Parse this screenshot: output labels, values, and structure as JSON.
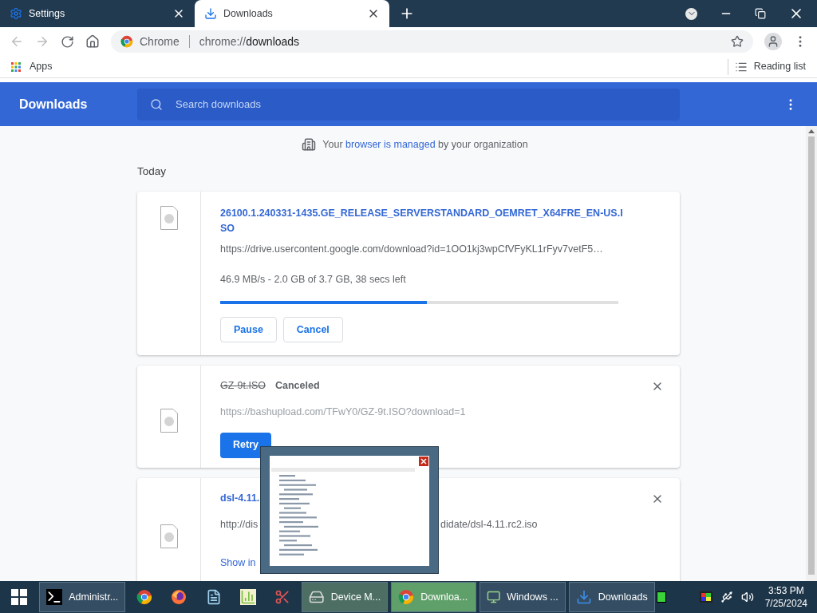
{
  "browser_tabs": [
    {
      "title": "Settings",
      "kind": "gear",
      "selected": false
    },
    {
      "title": "Downloads",
      "kind": "download",
      "selected": true
    }
  ],
  "address_bar": {
    "site": "Chrome",
    "url_prefix": "chrome://",
    "url_path": "downloads"
  },
  "bookmarks_bar": {
    "apps": "Apps",
    "reading_list": "Reading list"
  },
  "header": {
    "title": "Downloads",
    "search_placeholder": "Search downloads"
  },
  "managed_notice": {
    "before": "Your",
    "link": "browser is managed",
    "after": "by your organization"
  },
  "section_title": "Today",
  "downloads": [
    {
      "kind": "in_progress",
      "name": "26100.1.240331-1435.GE_RELEASE_SERVERSTANDARD_OEMRET_X64FRE_EN-US.ISO",
      "url": "https://drive.usercontent.google.com/download?id=1OO1kj3wpCfVFyKL1rFyv7vetF5…",
      "status": "46.9 MB/s - 2.0 GB of 3.7 GB, 38 secs left",
      "level": 0.52,
      "buttons": [
        "Pause",
        "Cancel"
      ]
    },
    {
      "kind": "canceled",
      "name": "GZ-9t.ISO",
      "status": "Canceled",
      "url": "https://bashupload.com/TFwY0/GZ-9t.ISO?download=1",
      "buttons": [
        "Retry"
      ]
    },
    {
      "kind": "complete",
      "name": "dsl-4.11.",
      "url_parts": [
        "http://dis",
        "didate/dsl-4.11.rc2.iso"
      ],
      "link": "Show in"
    }
  ],
  "taskbar": {
    "items": [
      {
        "kind": "terminal",
        "label": "Administr...",
        "selected": false,
        "hovered": false
      },
      {
        "kind": "chrome",
        "selected": false,
        "hovered": false
      },
      {
        "kind": "firefox",
        "selected": false,
        "hovered": false
      },
      {
        "kind": "notepad",
        "selected": false,
        "hovered": false
      },
      {
        "kind": "chart",
        "selected": false,
        "hovered": false
      },
      {
        "kind": "scissors",
        "selected": false,
        "hovered": false
      },
      {
        "kind": "device",
        "label": "Device M...",
        "selected": false,
        "hovered": true
      },
      {
        "kind": "chrome",
        "label": "Downloa...",
        "selected": true,
        "hovered": false
      },
      {
        "kind": "monitor",
        "label": "Windows ...",
        "selected": false,
        "hovered": false
      },
      {
        "kind": "download",
        "label": "Downloads",
        "selected": false,
        "hovered": false
      }
    ],
    "time": "3:53 PM",
    "date": "7/25/2024"
  }
}
